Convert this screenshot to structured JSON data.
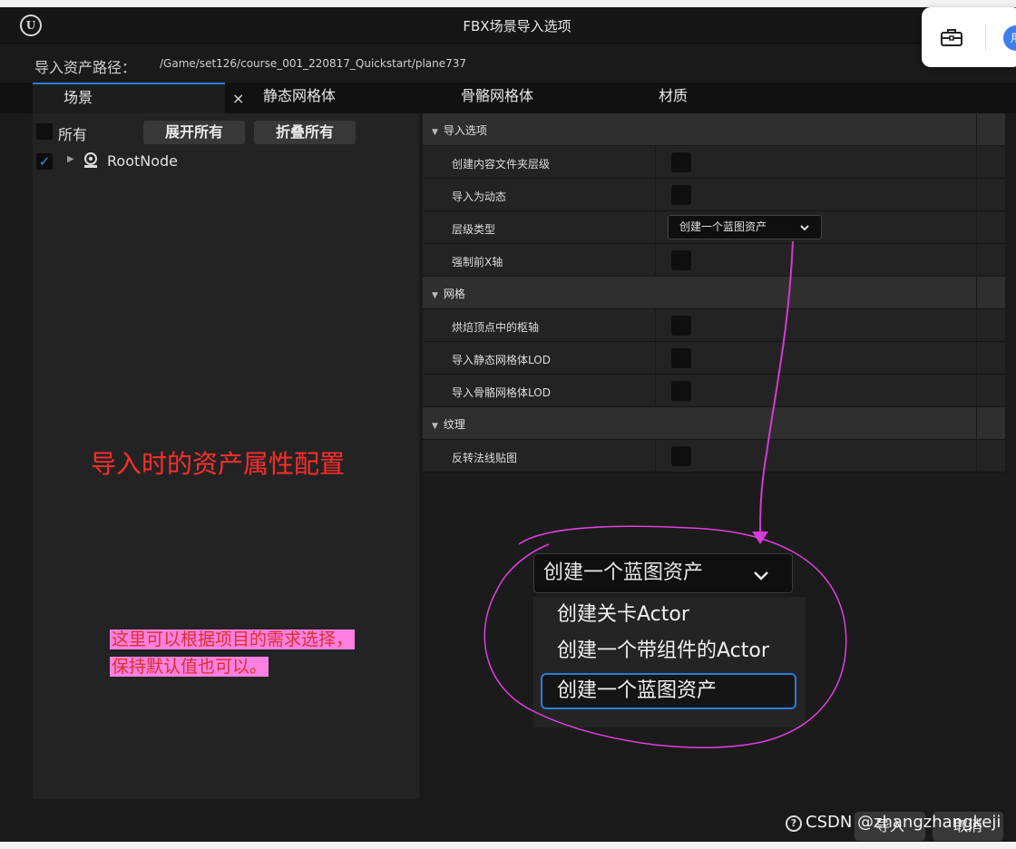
{
  "window": {
    "title": "FBX场景导入选项",
    "logo_text": "U"
  },
  "path": {
    "label": "导入资产路径：",
    "value": "/Game/set126/course_001_220817_Quickstart/plane737"
  },
  "tabs": [
    {
      "label": "场景",
      "active": true,
      "close": "×"
    },
    {
      "label": "静态网格体"
    },
    {
      "label": "骨骼网格体"
    },
    {
      "label": "材质"
    }
  ],
  "left_panel": {
    "all_label": "所有",
    "expand_all": "展开所有",
    "collapse_all": "折叠所有",
    "tree": [
      {
        "label": "RootNode",
        "checked": true,
        "checkmark": "✓",
        "icon": "actor-icon"
      }
    ]
  },
  "options": {
    "sections": [
      {
        "title": "导入选项",
        "items": [
          {
            "label": "创建内容文件夹层级",
            "type": "checkbox"
          },
          {
            "label": "导入为动态",
            "type": "checkbox"
          },
          {
            "label": "层级类型",
            "type": "combo",
            "value": "创建一个蓝图资产"
          },
          {
            "label": "强制前X轴",
            "type": "checkbox"
          }
        ]
      },
      {
        "title": "网格",
        "items": [
          {
            "label": "烘焙顶点中的枢轴",
            "type": "checkbox"
          },
          {
            "label": "导入静态网格体LOD",
            "type": "checkbox"
          },
          {
            "label": "导入骨骼网格体LOD",
            "type": "checkbox"
          }
        ]
      },
      {
        "title": "纹理",
        "items": [
          {
            "label": "反转法线贴图",
            "type": "checkbox"
          }
        ]
      }
    ]
  },
  "zoom_dropdown": {
    "current": "创建一个蓝图资产",
    "options": [
      "创建关卡Actor",
      "创建一个带组件的Actor",
      "创建一个蓝图资产"
    ],
    "selected_index": 2
  },
  "annotations": {
    "red_text": "导入时的资产属性配置",
    "pink_line1": "这里可以根据项目的需求选择，",
    "pink_line2": "保持默认值也可以。"
  },
  "footer": {
    "help": "?",
    "import": "导入",
    "cancel": "取消",
    "watermark": "CSDN @zhangzhangkeji"
  },
  "floating_toolbar": {
    "avatar_text": "用"
  },
  "colors": {
    "accent_blue": "#2c7bd9",
    "annotation_magenta": "#e040e0",
    "annotation_red": "#ff2d2d",
    "annotation_highlight": "#ff80e0"
  }
}
